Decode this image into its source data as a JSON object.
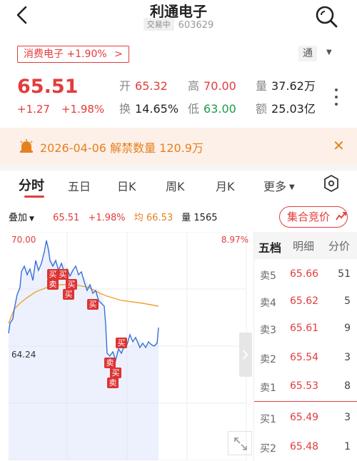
{
  "header": {
    "title": "利通电子",
    "status_tag": "交易中",
    "code": "603629"
  },
  "sector": {
    "label": "消费电子 +1.90%",
    "arrow": ">"
  },
  "market_switch": {
    "label": "通",
    "caret": "▼"
  },
  "quote": {
    "price": "65.51",
    "change": "+1.27",
    "change_pct": "+1.98%",
    "stats": [
      {
        "label": "开",
        "value": "65.32",
        "tone": "red"
      },
      {
        "label": "高",
        "value": "70.00",
        "tone": "red"
      },
      {
        "label": "量",
        "value": "37.62万",
        "tone": "dark"
      },
      {
        "label": "换",
        "value": "14.65%",
        "tone": "dark"
      },
      {
        "label": "低",
        "value": "63.00",
        "tone": "green"
      },
      {
        "label": "额",
        "value": "25.03亿",
        "tone": "dark"
      }
    ]
  },
  "notice": {
    "text": "2026-04-06 解禁数量 120.9万",
    "close": "✕"
  },
  "tabs": [
    {
      "label": "分时",
      "active": true
    },
    {
      "label": "五日"
    },
    {
      "label": "日K"
    },
    {
      "label": "周K"
    },
    {
      "label": "月K"
    },
    {
      "label": "更多"
    }
  ],
  "overlay": {
    "label": "叠加",
    "price": "65.51",
    "pct": "+1.98%",
    "avg": "均 66.53",
    "vol": "量 1565"
  },
  "auction_button": "集合竞价",
  "chart_labels": {
    "top_price": "70.00",
    "top_pct": "8.97%",
    "low_price": "64.24"
  },
  "orderbook": {
    "tabs": [
      "五档",
      "明细",
      "分价"
    ],
    "asks": [
      {
        "label": "卖5",
        "price": "65.66",
        "vol": "51"
      },
      {
        "label": "卖4",
        "price": "65.62",
        "vol": "5"
      },
      {
        "label": "卖3",
        "price": "65.61",
        "vol": "9"
      },
      {
        "label": "卖2",
        "price": "65.54",
        "vol": "3"
      },
      {
        "label": "卖1",
        "price": "65.53",
        "vol": "8"
      }
    ],
    "bids": [
      {
        "label": "买1",
        "price": "65.49",
        "vol": "3"
      },
      {
        "label": "买2",
        "price": "65.48",
        "vol": "1"
      }
    ]
  },
  "trade_markers": [
    "买",
    "买",
    "买",
    "卖",
    "买",
    "买",
    "买",
    "卖",
    "买",
    "卖"
  ],
  "colors": {
    "up": "#e23c3c",
    "down": "#1b9e46",
    "price_line": "#3a6fd8",
    "avg_line": "#f0a030",
    "notice_bg": "#fdf0e8",
    "notice_text": "#e5801f"
  },
  "icons": {
    "back": "chevron-left-icon",
    "search": "search-icon",
    "more": "vertical-dots-icon",
    "notice": "bell-icon",
    "settings": "hexagon-settings-icon",
    "expand": "expand-icon"
  }
}
